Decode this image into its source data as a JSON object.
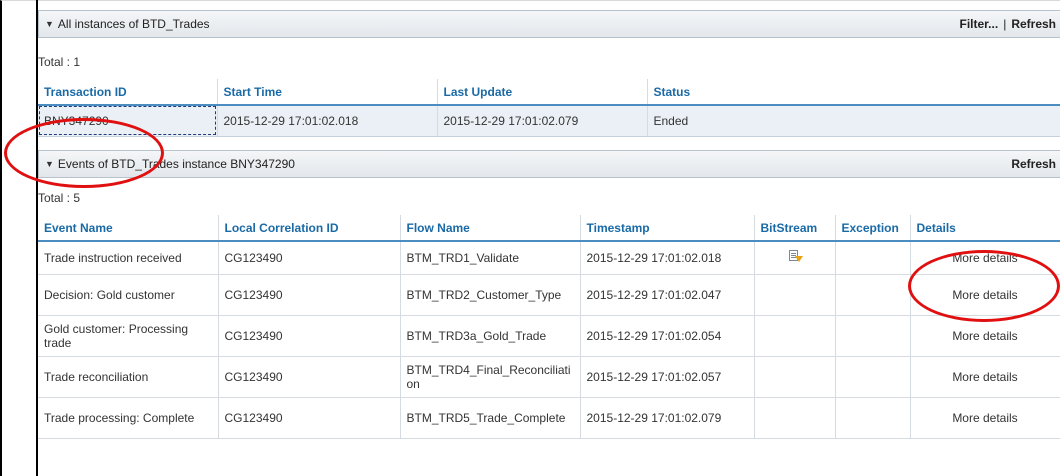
{
  "instances_panel": {
    "title": "All instances of BTD_Trades",
    "filter_label": "Filter...",
    "separator": "|",
    "refresh_label": "Refresh",
    "total": "Total : 1",
    "columns": [
      "Transaction ID",
      "Start Time",
      "Last Update",
      "Status"
    ],
    "rows": [
      {
        "transaction_id": "BNY347290",
        "start_time": "2015-12-29 17:01:02.018",
        "last_update": "2015-12-29 17:01:02.079",
        "status": "Ended"
      }
    ]
  },
  "events_panel": {
    "title": "Events of BTD_Trades instance BNY347290",
    "refresh_label": "Refresh",
    "total": "Total : 5",
    "columns": [
      "Event Name",
      "Local Correlation ID",
      "Flow Name",
      "Timestamp",
      "BitStream",
      "Exception",
      "Details"
    ],
    "rows": [
      {
        "event_name": "Trade instruction received",
        "correlation_id": "CG123490",
        "flow_name": "BTM_TRD1_Validate",
        "timestamp": "2015-12-29 17:01:02.018",
        "bitstream_icon": "document-download-icon",
        "exception": "",
        "details": "More details"
      },
      {
        "event_name": "Decision: Gold customer",
        "correlation_id": "CG123490",
        "flow_name": "BTM_TRD2_Customer_Type",
        "timestamp": "2015-12-29 17:01:02.047",
        "bitstream_icon": "",
        "exception": "",
        "details": "More details"
      },
      {
        "event_name": "Gold customer: Processing trade",
        "correlation_id": "CG123490",
        "flow_name": "BTM_TRD3a_Gold_Trade",
        "timestamp": "2015-12-29 17:01:02.054",
        "bitstream_icon": "",
        "exception": "",
        "details": "More details"
      },
      {
        "event_name": "Trade reconciliation",
        "correlation_id": "CG123490",
        "flow_name": "BTM_TRD4_Final_Reconciliation",
        "timestamp": "2015-12-29 17:01:02.057",
        "bitstream_icon": "",
        "exception": "",
        "details": "More details"
      },
      {
        "event_name": "Trade processing: Complete",
        "correlation_id": "CG123490",
        "flow_name": "BTM_TRD5_Trade_Complete",
        "timestamp": "2015-12-29 17:01:02.079",
        "bitstream_icon": "",
        "exception": "",
        "details": "More details"
      }
    ]
  },
  "colors": {
    "header_link": "#1a6aa6",
    "annotation": "#e01010"
  }
}
